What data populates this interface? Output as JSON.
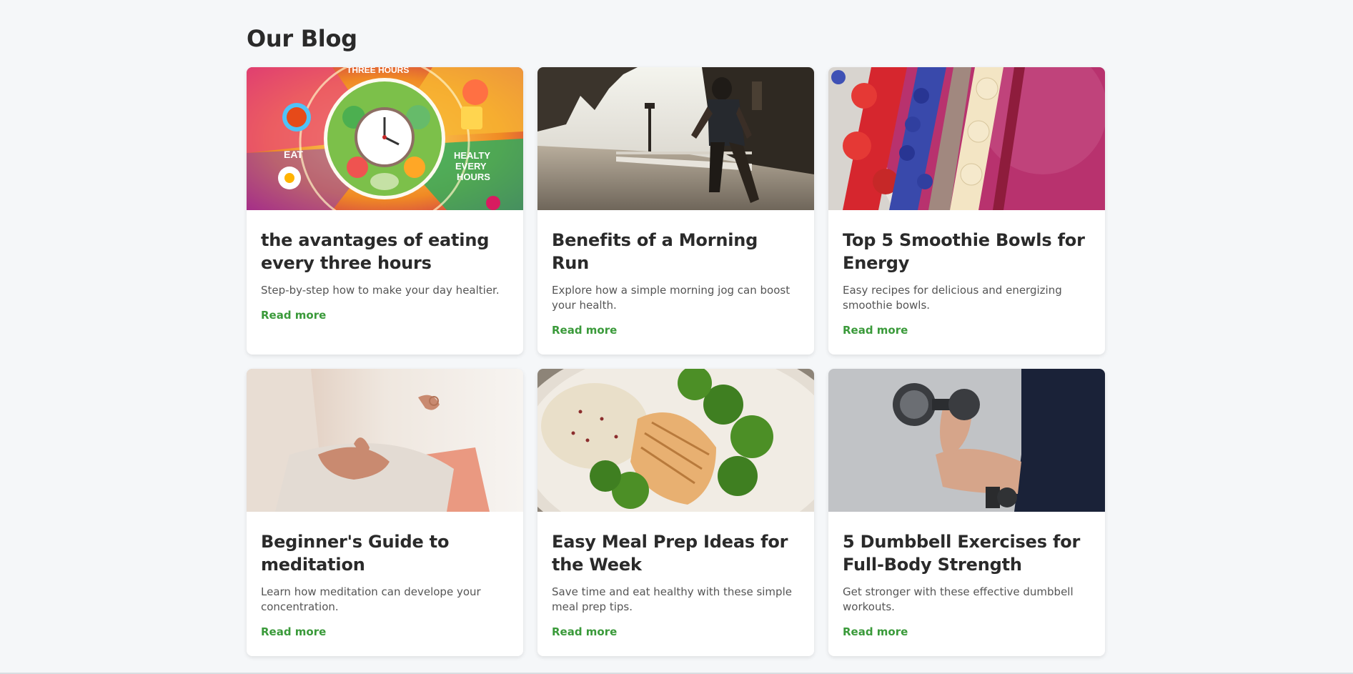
{
  "blog": {
    "heading": "Our Blog",
    "posts": [
      {
        "title": "the avantages of eating every three hours",
        "description": "Step-by-step how to make your day healtier.",
        "link": "Read more",
        "image": "healthy-meal-clock-illustration",
        "image_text": [
          "EAT",
          "THREE HOURS",
          "HEALTY",
          "EVERY",
          "HOURS"
        ]
      },
      {
        "title": "Benefits of a Morning Run",
        "description": "Explore how a simple morning jog can boost your health.",
        "link": "Read more",
        "image": "runner-on-bridge-photo"
      },
      {
        "title": "Top 5 Smoothie Bowls for Energy",
        "description": "Easy recipes for delicious and energizing smoothie bowls.",
        "link": "Read more",
        "image": "smoothie-bowl-photo"
      },
      {
        "title": "Beginner's Guide to meditation",
        "description": "Learn how meditation can develope your concentration.",
        "link": "Read more",
        "image": "meditation-hands-photo"
      },
      {
        "title": "Easy Meal Prep Ideas for the Week",
        "description": "Save time and eat healthy with these simple meal prep tips.",
        "link": "Read more",
        "image": "chicken-broccoli-quinoa-photo"
      },
      {
        "title": "5 Dumbbell Exercises for Full-Body Strength",
        "description": "Get stronger with these effective dumbbell workouts.",
        "link": "Read more",
        "image": "dumbbell-curl-photo"
      }
    ]
  },
  "colors": {
    "background": "#f5f7f9",
    "card": "#ffffff",
    "link": "#3a9a3a",
    "title": "#2a2a2a"
  }
}
